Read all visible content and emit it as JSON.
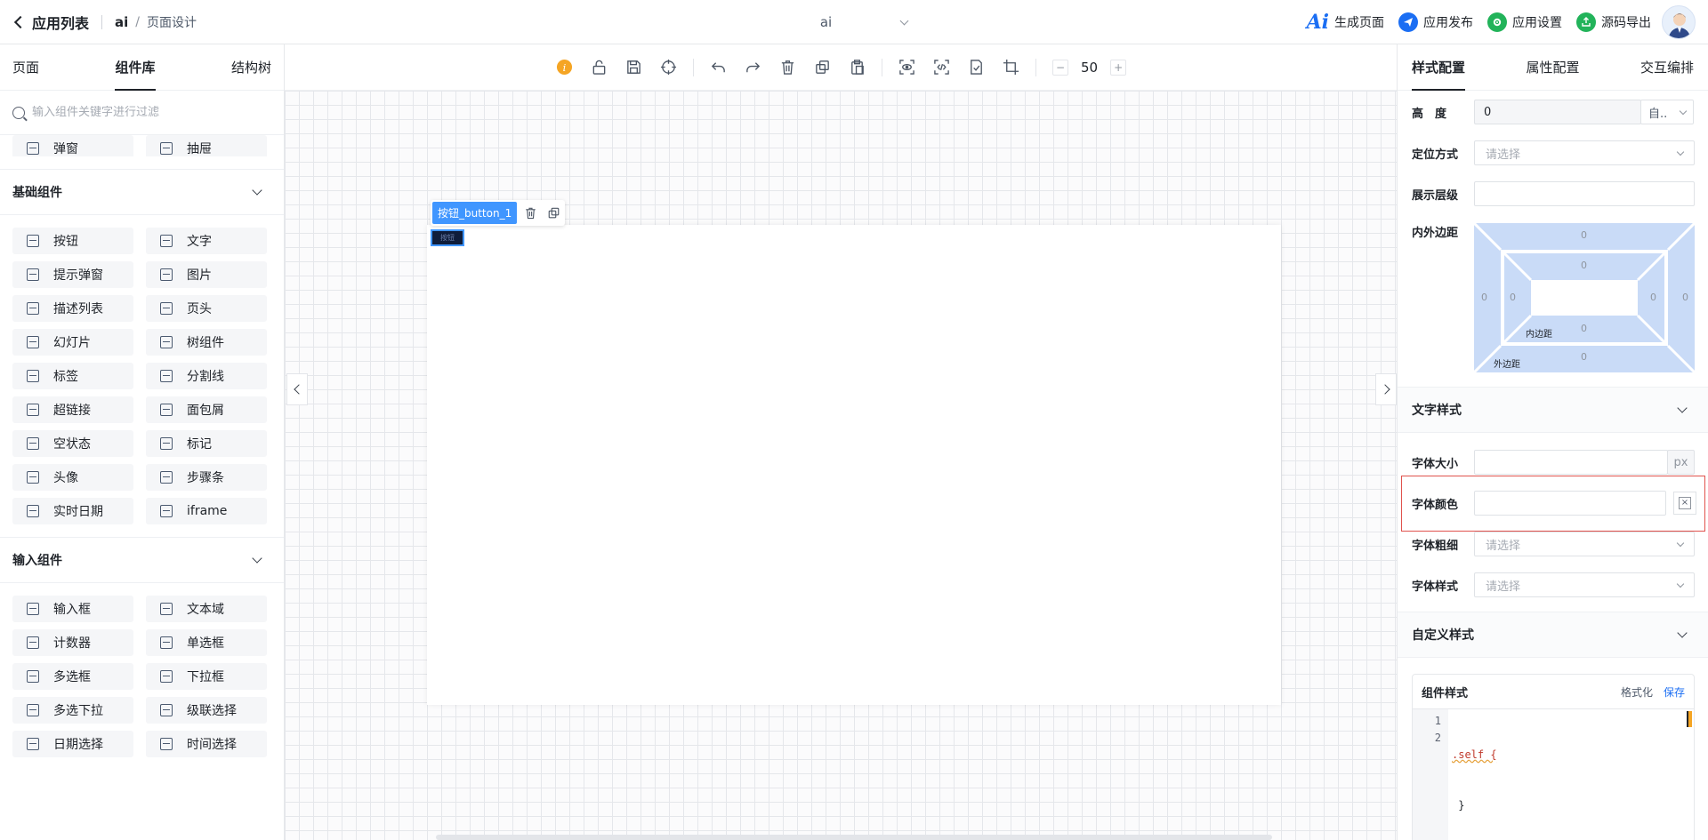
{
  "header": {
    "back_label": "应用列表",
    "app_name": "ai",
    "crumb_sep": "/",
    "page_name": "页面设计",
    "app_select_value": "ai",
    "actions": [
      {
        "label": "生成页面",
        "icon": "ai-logo-icon",
        "logo_text": "Ai"
      },
      {
        "label": "应用发布",
        "icon": "send-icon",
        "color": "#1b6ef3"
      },
      {
        "label": "应用设置",
        "icon": "settings-icon",
        "color": "#22b35a"
      },
      {
        "label": "源码导出",
        "icon": "export-icon",
        "color": "#22b35a"
      }
    ]
  },
  "left": {
    "tabs": [
      "页面",
      "组件库",
      "结构树"
    ],
    "active_tab": 1,
    "search_placeholder": "输入组件关键字进行过滤",
    "top_items": [
      {
        "label": "弹窗",
        "icon": "modal-icon"
      },
      {
        "label": "抽屉",
        "icon": "drawer-icon"
      }
    ],
    "sections": [
      {
        "title": "基础组件",
        "items": [
          {
            "label": "按钮",
            "icon": "button-icon"
          },
          {
            "label": "文字",
            "icon": "text-icon"
          },
          {
            "label": "提示弹窗",
            "icon": "alert-modal-icon"
          },
          {
            "label": "图片",
            "icon": "image-icon"
          },
          {
            "label": "描述列表",
            "icon": "description-list-icon"
          },
          {
            "label": "页头",
            "icon": "page-header-icon"
          },
          {
            "label": "幻灯片",
            "icon": "slideshow-icon"
          },
          {
            "label": "树组件",
            "icon": "tree-icon"
          },
          {
            "label": "标签",
            "icon": "tag-icon"
          },
          {
            "label": "分割线",
            "icon": "divider-icon"
          },
          {
            "label": "超链接",
            "icon": "link-icon"
          },
          {
            "label": "面包屑",
            "icon": "breadcrumb-icon"
          },
          {
            "label": "空状态",
            "icon": "empty-state-icon"
          },
          {
            "label": "标记",
            "icon": "pin-icon"
          },
          {
            "label": "头像",
            "icon": "avatar-icon"
          },
          {
            "label": "步骤条",
            "icon": "steps-icon"
          },
          {
            "label": "实时日期",
            "icon": "calendar-icon"
          },
          {
            "label": "iframe",
            "icon": "iframe-icon"
          }
        ]
      },
      {
        "title": "输入组件",
        "items": [
          {
            "label": "输入框",
            "icon": "input-icon"
          },
          {
            "label": "文本域",
            "icon": "textarea-icon"
          },
          {
            "label": "计数器",
            "icon": "counter-icon"
          },
          {
            "label": "单选框",
            "icon": "radio-icon"
          },
          {
            "label": "多选框",
            "icon": "checkbox-icon"
          },
          {
            "label": "下拉框",
            "icon": "select-icon"
          },
          {
            "label": "多选下拉",
            "icon": "multi-select-icon"
          },
          {
            "label": "级联选择",
            "icon": "cascader-icon"
          },
          {
            "label": "日期选择",
            "icon": "date-picker-icon"
          },
          {
            "label": "时间选择",
            "icon": "time-picker-icon"
          }
        ]
      }
    ]
  },
  "toolbar": {
    "zoom_value": "50",
    "zoom_minus": "−",
    "zoom_plus": "+"
  },
  "canvas": {
    "selected_label": "按钮_button_1",
    "button_text": "按钮"
  },
  "right": {
    "tabs": [
      "样式配置",
      "属性配置",
      "交互编排"
    ],
    "active_tab": 0,
    "height_label": "高　度",
    "height_value": "0",
    "height_unit": "自..",
    "position_label": "定位方式",
    "position_placeholder": "请选择",
    "zindex_label": "展示层级",
    "spacing_label": "内外边距",
    "spacing": {
      "margin_top": "0",
      "margin_left": "0",
      "margin_right": "0",
      "margin_bottom": "0",
      "padding_top": "0",
      "padding_left": "0",
      "padding_right": "0",
      "padding_bottom": "0",
      "padding_label": "内边距",
      "margin_label": "外边距"
    },
    "text_style_title": "文字样式",
    "font_size_label": "字体大小",
    "font_size_unit": "px",
    "font_color_label": "字体颜色",
    "font_weight_label": "字体粗细",
    "font_weight_placeholder": "请选择",
    "font_style_label": "字体样式",
    "font_style_placeholder": "请选择",
    "custom_style_title": "自定义样式",
    "code_title": "组件样式",
    "format_label": "格式化",
    "save_label": "保存",
    "code_lines": [
      ".self {",
      " }"
    ],
    "line_numbers": [
      "1",
      "2"
    ]
  }
}
